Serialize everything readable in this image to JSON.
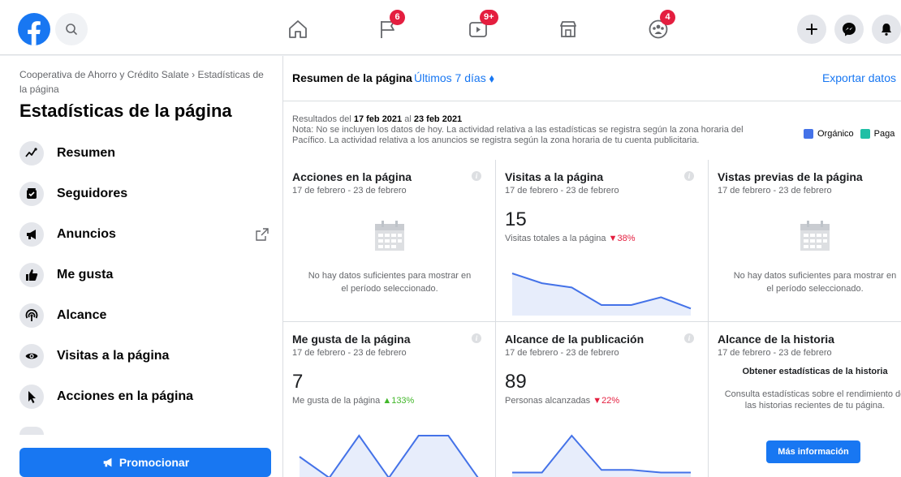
{
  "topbar": {
    "badges": {
      "flag": "6",
      "watch": "9+",
      "groups": "4"
    }
  },
  "sidebar": {
    "breadcrumb": "Cooperativa de Ahorro y Crédito Salate › Estadísticas de la página",
    "title": "Estadísticas de la página",
    "items": [
      {
        "label": "Resumen",
        "icon": "trend-icon"
      },
      {
        "label": "Seguidores",
        "icon": "followers-icon"
      },
      {
        "label": "Anuncios",
        "icon": "megaphone-icon"
      },
      {
        "label": "Me gusta",
        "icon": "thumbs-up-icon"
      },
      {
        "label": "Alcance",
        "icon": "reach-icon"
      },
      {
        "label": "Visitas a la página",
        "icon": "eye-icon"
      },
      {
        "label": "Acciones en la página",
        "icon": "cursor-icon"
      }
    ],
    "promote_label": "Promocionar"
  },
  "main": {
    "summary_title": "Resumen de la página",
    "period": "Últimos 7 días ⬧",
    "export": "Exportar datos",
    "results_prefix": "Resultados del",
    "date_from": "17 feb 2021",
    "results_mid": "al",
    "date_to": "23 feb 2021",
    "note": "Nota: No se incluyen los datos de hoy. La actividad relativa a las estadísticas se registra según la zona horaria del Pacífico. La actividad relativa a los anuncios se registra según la zona horaria de tu cuenta publicitaria.",
    "legend": {
      "organic": "Orgánico",
      "paid": "Paga",
      "organic_color": "#4472e8",
      "paid_color": "#1fbfa5"
    },
    "cards": [
      {
        "title": "Acciones en la página",
        "date": "17 de febrero - 23 de febrero",
        "nodata": "No hay datos suficientes para mostrar en el período seleccionado."
      },
      {
        "title": "Visitas a la página",
        "date": "17 de febrero - 23 de febrero",
        "value": "15",
        "label": "Visitas totales a la página",
        "change": "▼38%",
        "trend": [
          6,
          4.6,
          4,
          1.5,
          1.5,
          2.6,
          1
        ]
      },
      {
        "title": "Vistas previas de la página",
        "date": "17 de febrero - 23 de febrero",
        "nodata": "No hay datos suficientes para mostrar en el período seleccionado."
      },
      {
        "title": "Me gusta de la página",
        "date": "17 de febrero - 23 de febrero",
        "value": "7",
        "label": "Me gusta de la página",
        "change": "▲133%",
        "trend": [
          1,
          0,
          2,
          0,
          2,
          2,
          0
        ]
      },
      {
        "title": "Alcance de la publicación",
        "date": "17 de febrero - 23 de febrero",
        "value": "89",
        "label": "Personas alcanzadas",
        "change": "▼22%",
        "trend": [
          1,
          1,
          8,
          1.5,
          1.5,
          1,
          1
        ]
      },
      {
        "title": "Alcance de la historia",
        "date": "17 de febrero - 23 de febrero",
        "story_head": "Obtener estadísticas de la historia",
        "story_text": "Consulta estadísticas sobre el rendimiento de las historias recientes de tu página.",
        "button": "Más información"
      }
    ]
  }
}
